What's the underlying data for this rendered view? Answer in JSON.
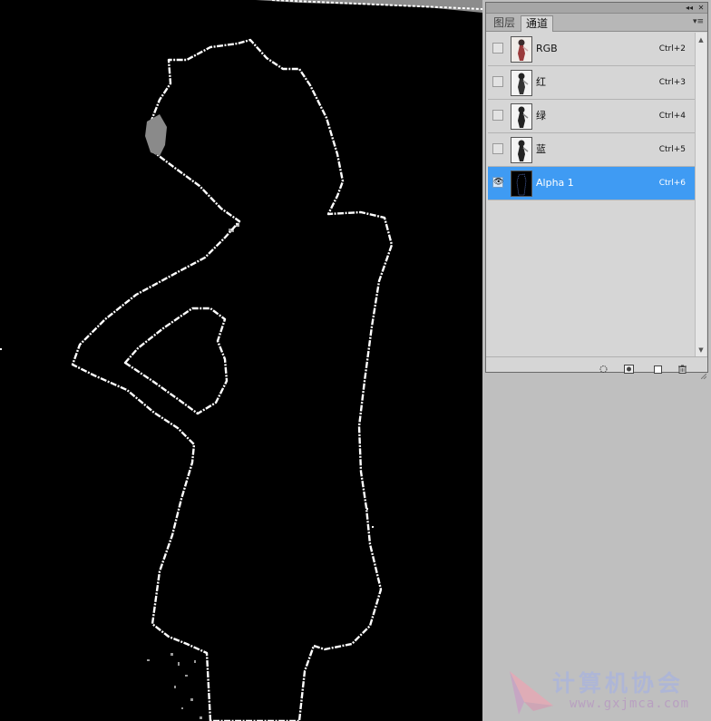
{
  "panel": {
    "tabs": [
      {
        "label": "图层",
        "active": false
      },
      {
        "label": "通道",
        "active": true
      }
    ],
    "window_controls": {
      "collapse": "◂◂",
      "close": "✕"
    },
    "menu_icon": "panel-menu-icon",
    "channels": [
      {
        "name": "RGB",
        "shortcut": "Ctrl+2",
        "visible": false,
        "selected": false,
        "thumb": "color"
      },
      {
        "name": "红",
        "shortcut": "Ctrl+3",
        "visible": false,
        "selected": false,
        "thumb": "gray"
      },
      {
        "name": "绿",
        "shortcut": "Ctrl+4",
        "visible": false,
        "selected": false,
        "thumb": "gray"
      },
      {
        "name": "蓝",
        "shortcut": "Ctrl+5",
        "visible": false,
        "selected": false,
        "thumb": "gray"
      },
      {
        "name": "Alpha 1",
        "shortcut": "Ctrl+6",
        "visible": true,
        "selected": true,
        "thumb": "alpha"
      }
    ],
    "footer_icons": [
      "load-selection-icon",
      "save-selection-icon",
      "new-channel-icon",
      "delete-channel-icon"
    ],
    "colors": {
      "selected_row": "#3f9bf3",
      "panel_bg": "#d6d6d6"
    }
  },
  "watermark": {
    "text": "计算机协会",
    "url": "www.gxjmca.com"
  }
}
